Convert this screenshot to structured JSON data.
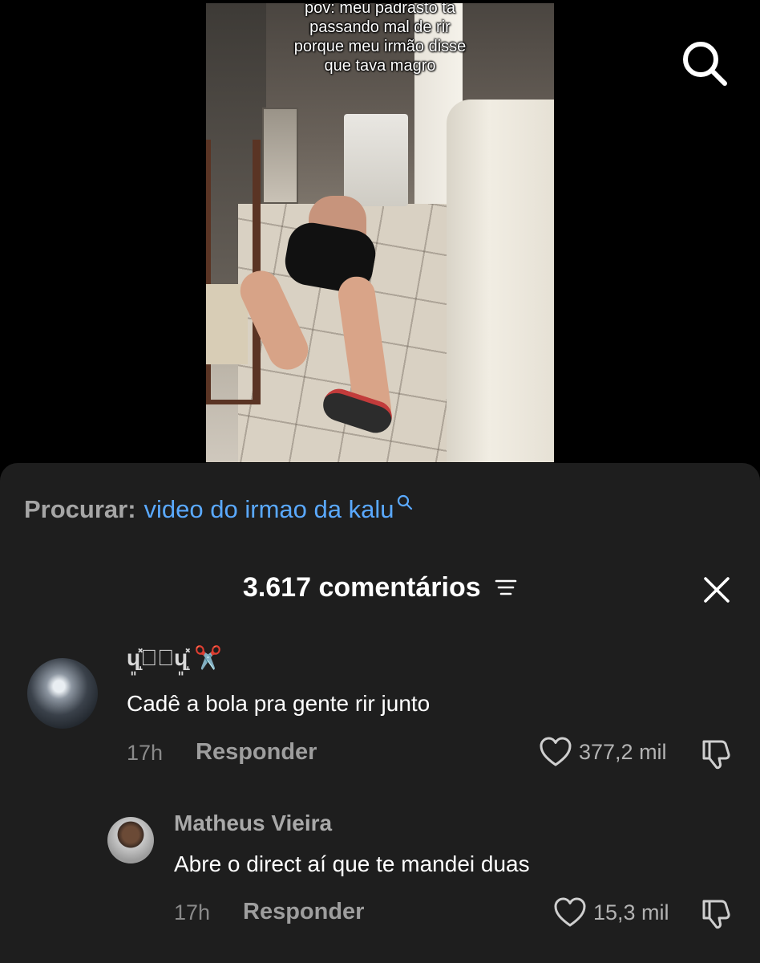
{
  "video": {
    "caption_lines": [
      "pov: meu padrasto ta",
      "passando mal de rir",
      "porque meu irmão disse",
      "que tava magro"
    ],
    "search_icon": "search-icon"
  },
  "search_suggestion": {
    "label": "Procurar:",
    "query": "video do irmao da kalu",
    "icon": "search-icon"
  },
  "comments_header": {
    "title": "3.617 comentários",
    "filter_icon": "filter-icon",
    "close_icon": "close-icon"
  },
  "comments": [
    {
      "username": "ɥ͈̝̽ᜊ᪶ɥ͈̝̽ ✂️",
      "text": "Cadê a bola pra gente rir junto",
      "time": "17h",
      "reply_label": "Responder",
      "likes": "377,2 mil"
    },
    {
      "username": "Matheus Vieira",
      "text": "Abre o direct aí que te mandei duas",
      "time": "17h",
      "reply_label": "Responder",
      "likes": "15,3 mil"
    }
  ],
  "colors": {
    "sheet_bg": "#1e1e1e",
    "link_blue": "#5aa9ff",
    "muted": "#8a8a8a"
  }
}
